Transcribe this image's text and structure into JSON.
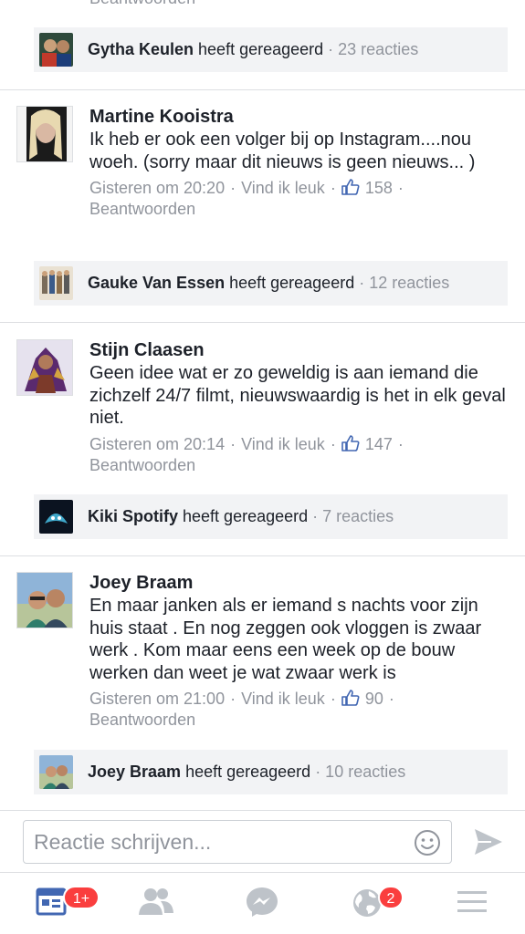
{
  "top_partial": {
    "text": "Beantwoorden"
  },
  "replies": [
    {
      "name": "Gytha Keulen",
      "action": " heeft gereageerd",
      "count": " · 23 reacties"
    },
    {
      "name": "Gauke Van Essen",
      "action": " heeft gereageerd",
      "count": " · 12 reacties"
    },
    {
      "name": "Kiki Spotify",
      "action": " heeft gereageerd",
      "count": " · 7 reacties"
    },
    {
      "name": "Joey Braam",
      "action": " heeft gereageerd",
      "count": " · 10 reacties"
    }
  ],
  "comments": [
    {
      "name": "Martine Kooistra",
      "text": "Ik heb er ook een volger bij op Instagram....nou woeh. (sorry maar dit nieuws is geen nieuws... )",
      "time": "Gisteren om 20:20",
      "like_label": "Vind ik leuk",
      "likes": "158",
      "reply_label": "Beantwoorden"
    },
    {
      "name": "Stijn Claasen",
      "text": "Geen idee wat er zo geweldig is aan iemand die zichzelf 24/7 filmt, nieuwswaardig is het in elk geval niet.",
      "time": "Gisteren om 20:14",
      "like_label": "Vind ik leuk",
      "likes": "147",
      "reply_label": "Beantwoorden"
    },
    {
      "name": "Joey Braam",
      "text": "En maar janken als er iemand  s nachts voor zijn huis staat . En nog zeggen ook vloggen  is zwaar werk . Kom maar eens een week op de bouw werken  dan weet je wat zwaar werk is",
      "time": "Gisteren om 21:00",
      "like_label": "Vind ik leuk",
      "likes": "90",
      "reply_label": "Beantwoorden"
    }
  ],
  "composer": {
    "placeholder": "Reactie schrijven..."
  },
  "tabbar": {
    "news_feed_badge": "1+",
    "notifications_badge": "2"
  },
  "colors": {
    "brand": "#4267b2",
    "muted": "#90949c",
    "badge": "#fa3e3e",
    "reply_bg": "#f2f3f5"
  }
}
